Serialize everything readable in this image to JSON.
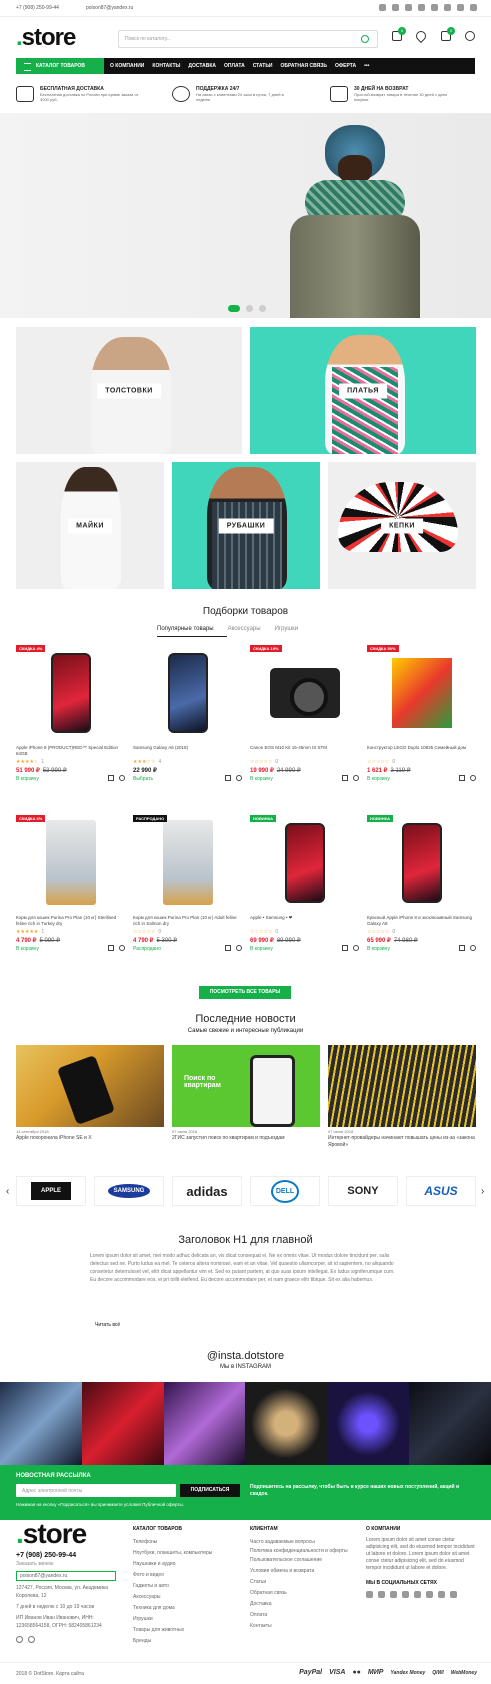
{
  "topbar": {
    "phone": "+7 (908) 250-99-44",
    "email": "poison87@yandex.ru"
  },
  "header": {
    "logo_dot": ".",
    "logo_text": "store",
    "search_placeholder": "Поиск по каталогу...",
    "compare_count": "0",
    "cart_count": "0"
  },
  "nav": {
    "catalog_label": "КАТАЛОГ ТОВАРОВ",
    "items": [
      "О КОМПАНИИ",
      "КОНТАКТЫ",
      "ДОСТАВКА",
      "ОПЛАТА",
      "СТАТЬИ",
      "ОБРАТНАЯ СВЯЗЬ",
      "ОФЕРТА",
      "•••"
    ]
  },
  "features": [
    {
      "title": "БЕСПЛАТНАЯ ДОСТАВКА",
      "desc": "Бесплатная доставка по России при сумме заказа от 3000 руб."
    },
    {
      "title": "ПОДДЕРЖКА 24/7",
      "desc": "На связи с клиентами 24 часа в сутки, 7 дней в неделю"
    },
    {
      "title": "30 ДНЕЙ НА ВОЗВРАТ",
      "desc": "Простой возврат товара в течение 30 дней с даты покупки"
    }
  ],
  "categories": [
    "ТОЛСТОВКИ",
    "ПЛАТЬЯ",
    "МАЙКИ",
    "РУБАШКИ",
    "КЕПКИ"
  ],
  "products_section": {
    "title": "Подборки товаров",
    "tabs": [
      "Популярные товары",
      "Аксессуары",
      "Игрушки"
    ]
  },
  "products": [
    {
      "sticker": "СКИДКА 4%",
      "name": "Apple iPhone 8 (PRODUCT)RED™ Special Edition 64GB",
      "stars": "★★★★☆",
      "reviews": "1",
      "price": "51 990 ₽",
      "old": "53 990 ₽",
      "action": "В корзину"
    },
    {
      "sticker": "",
      "name": "Samsung Galaxy A6 (2018)",
      "stars": "★★★☆☆",
      "reviews": "4",
      "price": "22 990 ₽",
      "old": "",
      "action": "Выбрать"
    },
    {
      "sticker": "СКИДКА 19%",
      "name": "Canon EOS M10 Kit 15-45mm IS STM",
      "stars": "☆☆☆☆☆",
      "reviews": "0",
      "price": "19 990 ₽",
      "old": "24 990 ₽",
      "action": "В корзину"
    },
    {
      "sticker": "СКИДКА 50%",
      "name": "Конструктор LEGO Duplo 10835 Семейный дом",
      "stars": "☆☆☆☆☆",
      "reviews": "0",
      "price": "1 621 ₽",
      "old": "3 119 ₽",
      "action": "В корзину"
    },
    {
      "sticker": "СКИДКА 6%",
      "name": "Корм для кошек Purina Pro Plan (10 кг) Sterilised feline rich in Turkey dry",
      "stars": "★★★★★",
      "reviews": "1",
      "price": "4 790 ₽",
      "old": "5 090 ₽",
      "action": "В корзину"
    },
    {
      "sticker": "РАСПРОДАНО",
      "name": "Корм для кошек Purina Pro Plan (10 кг) Adult feline rich in Salmon dry",
      "stars": "☆☆☆☆☆",
      "reviews": "0",
      "price": "4 790 ₽",
      "old": "5 300 ₽",
      "action": "Распродано"
    },
    {
      "sticker": "НОВИНКА",
      "name": "Apple • Samsung • ❤",
      "stars": "☆☆☆☆☆",
      "reviews": "0",
      "price": "69 990 ₽",
      "old": "89 990 ₽",
      "action": "В корзину"
    },
    {
      "sticker": "НОВИНКА",
      "name": "Красный Apple iPhone 8 и эксклюзивный Samsung Galaxy A8",
      "stars": "☆☆☆☆☆",
      "reviews": "0",
      "price": "65 990 ₽",
      "old": "74 980 ₽",
      "action": "В корзину"
    }
  ],
  "show_all": "ПОСМОТРЕТЬ ВСЕ ТОВАРЫ",
  "news_section": {
    "title": "Последние новости",
    "subtitle": "Самые свежие и интересные публикации"
  },
  "news": [
    {
      "date": "14 сентября 2018",
      "title": "Apple похоронила iPhone SE и X"
    },
    {
      "date": "07 июля 2018",
      "title": "2ГИС запустил поиск по квартирам и подъездам"
    },
    {
      "date": "07 июля 2018",
      "title": "Интернет-провайдеры начинают повышать цены из-за «закона Яровой»"
    }
  ],
  "brands": [
    "APPLE",
    "SAMSUNG",
    "adidas",
    "DELL",
    "SONY",
    "ASUS"
  ],
  "seo": {
    "title": "Заголовок H1 для главной",
    "text": "Lorem ipsum dolor sit amet, mei modo adhuc delicata an, vis dicat consequat ei. Ne ex omnis vitae. Ut modus dolore tincidunt per, salis delectus sed ne. Purto ludus ea mel. Te ceteros altera nominavi, eam et an vitae. Vel quaestio ullamcorper, sit id sapientem, no aliquando consetetur deterruisset vel, elitr dicat appellantur vim et. Sed ex putant partem, at quo suas ipsum intellegat. Ex ludus signiferumque cum. Eu decore accommodare eos, ei pri tollit eleifend. Eu decore accommodare per, et nam graece elitr tibique. Sit ex alia habemus.",
    "more": "Читать всё"
  },
  "insta": {
    "handle": "@insta.dotstore",
    "sub": "Мы в INSTAGRAM"
  },
  "newsletter": {
    "title": "НОВОСТНАЯ РАССЫЛКА",
    "placeholder": "Адрес электронной почты",
    "button": "ПОДПИСАТЬСЯ",
    "desc": "Подпишитесь на рассылку, чтобы быть в курсе наших новых поступлений, акций и скидок.",
    "note": "Нажимая на кнопку «Подписаться» вы принимаете условия Публичной оферты."
  },
  "footer": {
    "phone": "+7 (908) 250-99-44",
    "callback": "Заказать звонок",
    "email": "poison87@yandex.ru",
    "address": "127427, Россия, Москва, ул. Академика Королева, 12",
    "hours": "7 дней в неделю с 10 до 19 часов",
    "company": "ИП Иванов Иван Иванович, ИНН: 123658564158, ОГРН: 582405861234",
    "catalog_title": "КАТАЛОГ ТОВАРОВ",
    "catalog": [
      "Телефоны",
      "Ноутбуки, планшеты, компьютеры",
      "Наушники и аудио",
      "Фото и видео",
      "Гаджеты и авто",
      "Аксессуары",
      "Техника для дома",
      "Игрушки",
      "Товары для животных",
      "Бренды"
    ],
    "clients_title": "КЛИЕНТАМ",
    "clients": [
      "Часто задаваемые вопросы",
      "Политика конфиденциальности и оферты",
      "Пользовательское соглашение",
      "Условия обмена и возврата",
      "Статьи",
      "Обратная связь",
      "Доставка",
      "Оплата",
      "Контакты"
    ],
    "about_title": "О КОМПАНИИ",
    "about": "Lorem ipsum dolor sit amet conse ctetur adipisicing elit, sed do eiusmod tempor incididunt ut labore et dolore. Lorem ipsum dolor sit amet conse ctetur adipisicing elit, sed do eiusmod tempor incididunt ut labore et dolore.",
    "social_title": "МЫ В СОЦИАЛЬНЫХ СЕТЯХ",
    "copyright": "2018 © DotStore. Карта сайта",
    "payments": [
      "PayPal",
      "VISA",
      "●●",
      "МИР",
      "Yandex Money",
      "QIWI",
      "WebMoney"
    ]
  },
  "colors": {
    "accent": "#16b04a",
    "dark": "#111111",
    "sale": "#e11d2b"
  }
}
